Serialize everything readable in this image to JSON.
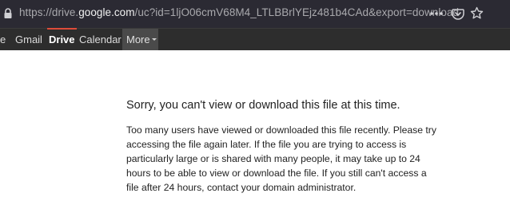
{
  "browser": {
    "url_prefix": "https://drive.",
    "url_host": "google.com",
    "url_path": "/uc?id=1ljO06cmV68M4_LTLBBrlYEjz481b4CAd&export=download",
    "icons": [
      "lock-icon",
      "more-icon",
      "pocket-icon",
      "star-icon"
    ]
  },
  "google_bar": {
    "items": [
      {
        "label": "e",
        "active": false
      },
      {
        "label": "Gmail",
        "active": false
      },
      {
        "label": "Drive",
        "active": true
      },
      {
        "label": "Calendar",
        "active": false
      }
    ],
    "more_label": "More"
  },
  "error": {
    "title": "Sorry, you can't view or download this file at this time.",
    "body": "Too many users have viewed or downloaded this file recently. Please try accessing the file again later. If the file you are trying to access is particularly large or is shared with many people, it may take up to 24 hours to be able to view or download the file. If you still can't access a file after 24 hours, contact your domain administrator."
  },
  "colors": {
    "urlbar_bg": "#2b2a33",
    "navbar_bg": "#2d2d2d",
    "active_indicator": "#dd4b39"
  }
}
